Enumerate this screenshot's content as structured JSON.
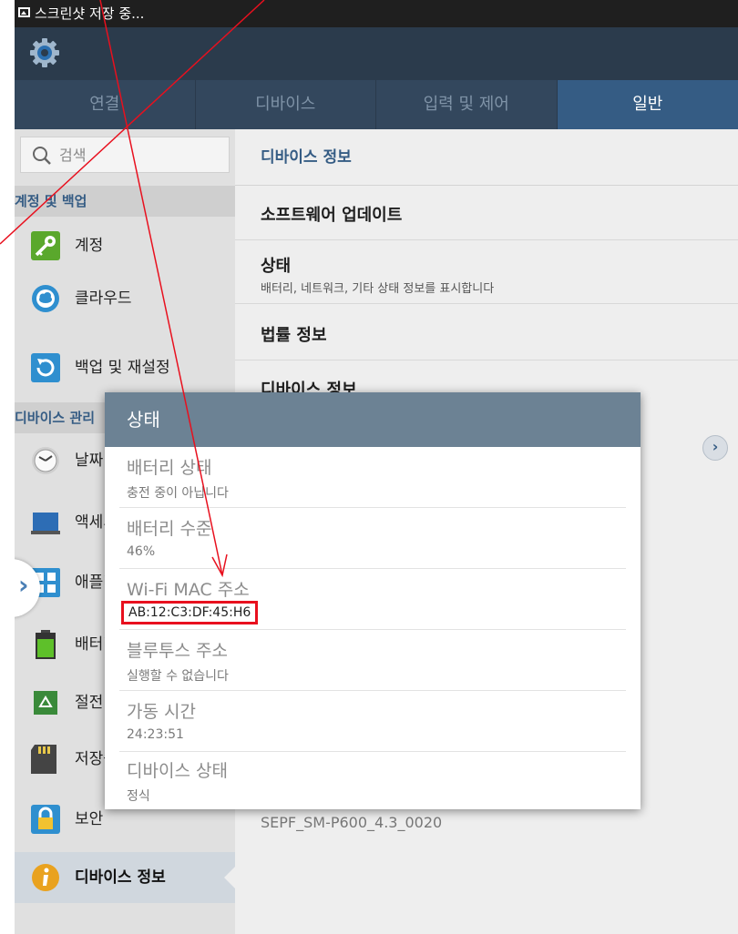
{
  "status_bar": {
    "text": "스크린샷 저장 중..."
  },
  "action_bar": {
    "icon": "settings-gear-icon"
  },
  "tabs": [
    {
      "label": "연결",
      "active": false
    },
    {
      "label": "디바이스",
      "active": false
    },
    {
      "label": "입력 및 제어",
      "active": false
    },
    {
      "label": "일반",
      "active": true
    }
  ],
  "sidebar": {
    "search_placeholder": "검색",
    "section_account": "계정 및 백업",
    "items_account": [
      {
        "label": "계정",
        "icon": "key-icon"
      },
      {
        "label": "클라우드",
        "icon": "cloud-icon"
      },
      {
        "label": "백업 및 재설정",
        "icon": "backup-reset-icon"
      }
    ],
    "section_device": "디바이스 관리",
    "items_device": [
      {
        "label": "날짜 및 시간",
        "icon": "clock-icon"
      },
      {
        "label": "액세서리",
        "icon": "accessory-icon"
      },
      {
        "label": "애플리케이션",
        "icon": "apps-grid-icon"
      },
      {
        "label": "배터리",
        "icon": "battery-icon"
      },
      {
        "label": "절전 모드",
        "icon": "power-saving-icon"
      },
      {
        "label": "저장공간",
        "icon": "sd-card-icon"
      },
      {
        "label": "보안",
        "icon": "lock-icon"
      },
      {
        "label": "디바이스 정보",
        "icon": "info-icon",
        "selected": true
      }
    ]
  },
  "main": {
    "title": "디바이스 정보",
    "items": [
      {
        "title": "소프트웨어 업데이트"
      },
      {
        "title": "상태",
        "subtitle": "배터리, 네트워크, 기타 상태 정보를 표시합니다"
      },
      {
        "title": "법률 정보"
      },
      {
        "title": "디바이스 정보"
      }
    ],
    "build_number": "SEPF_SM-P600_4.3_0020"
  },
  "dialog": {
    "title": "상태",
    "rows": [
      {
        "label": "배터리 상태",
        "value": "충전 중이 아닙니다"
      },
      {
        "label": "배터리 수준",
        "value": "46%"
      },
      {
        "label": "Wi-Fi MAC 주소",
        "value": "AB:12:C3:DF:45:H6",
        "highlighted": true
      },
      {
        "label": "블루투스 주소",
        "value": "실행할 수 없습니다"
      },
      {
        "label": "가동 시간",
        "value": "24:23:51"
      },
      {
        "label": "디바이스 상태",
        "value": "정식"
      }
    ]
  },
  "annotation_color": "#e8101e"
}
